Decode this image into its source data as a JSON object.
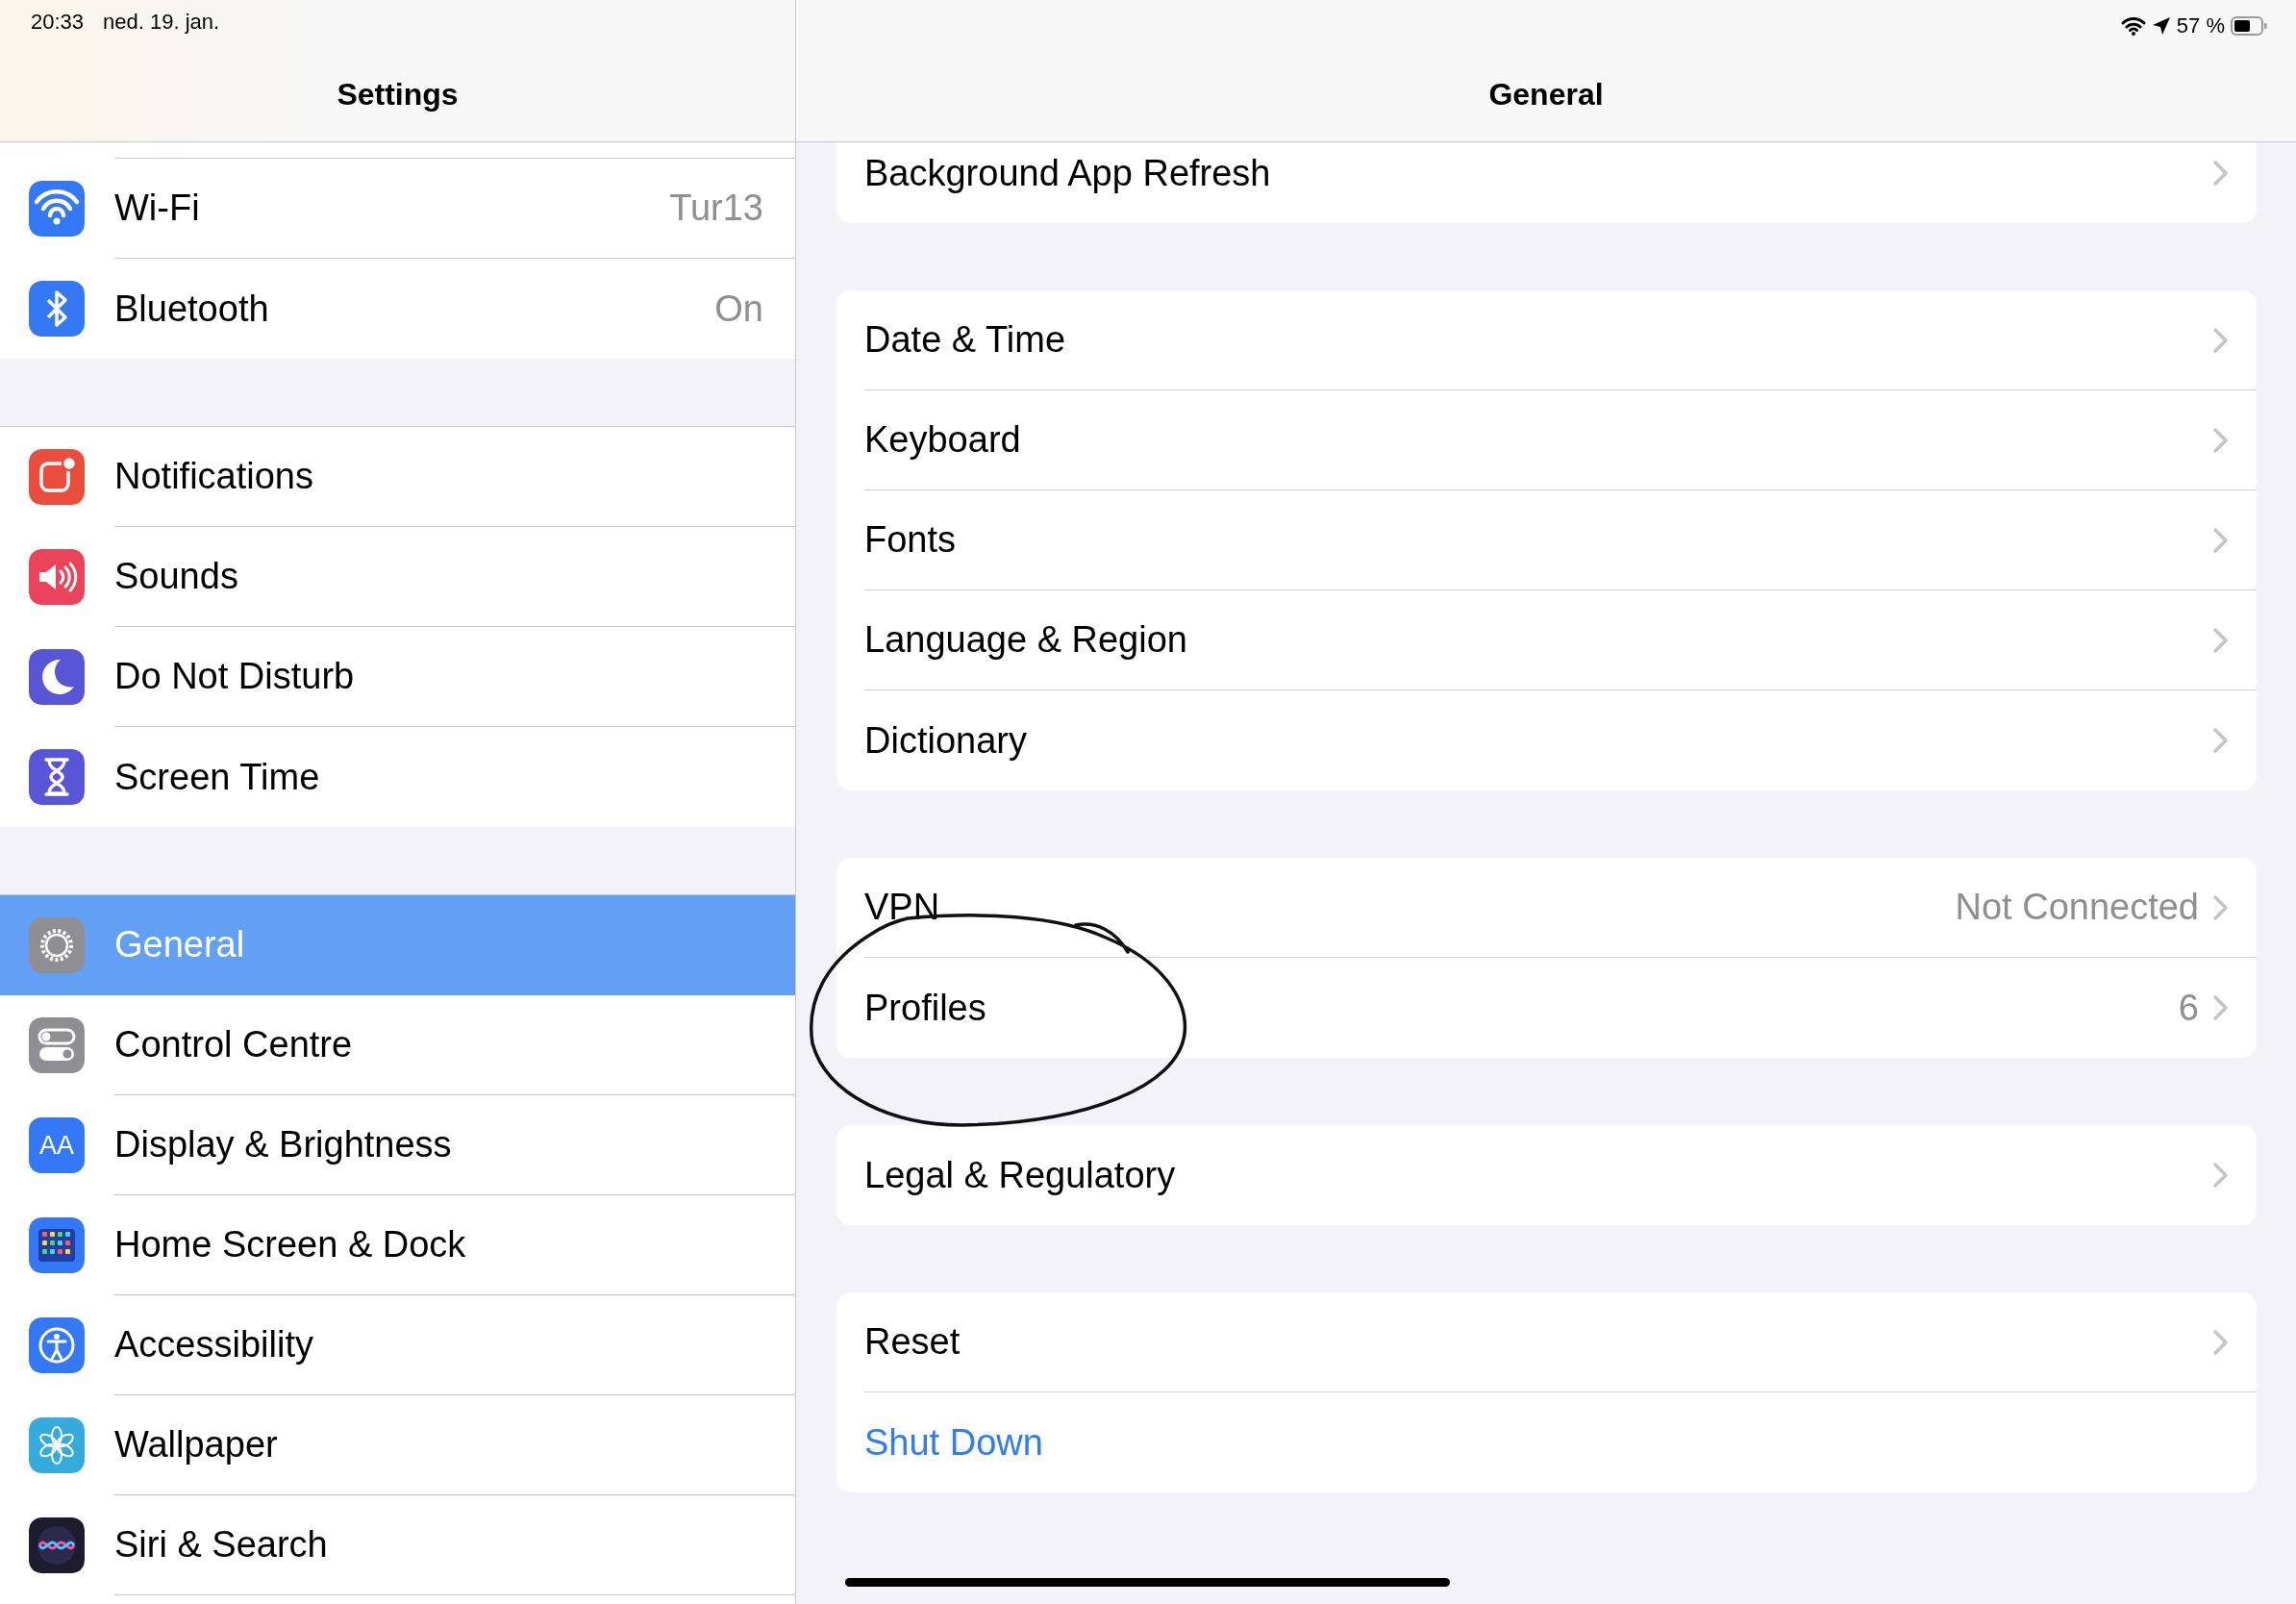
{
  "status_bar": {
    "time": "20:33",
    "date": "ned. 19. jan.",
    "battery": "57 %"
  },
  "sidebar": {
    "title": "Settings",
    "groups": [
      [
        {
          "label": "Wi-Fi",
          "value": "Tur13",
          "selected": false
        },
        {
          "label": "Bluetooth",
          "value": "On",
          "selected": false
        }
      ],
      [
        {
          "label": "Notifications",
          "selected": false
        },
        {
          "label": "Sounds",
          "selected": false
        },
        {
          "label": "Do Not Disturb",
          "selected": false
        },
        {
          "label": "Screen Time",
          "selected": false
        }
      ],
      [
        {
          "label": "General",
          "selected": true
        },
        {
          "label": "Control Centre",
          "selected": false
        },
        {
          "label": "Display & Brightness",
          "icon_text": "AA",
          "selected": false
        },
        {
          "label": "Home Screen & Dock",
          "selected": false
        },
        {
          "label": "Accessibility",
          "selected": false
        },
        {
          "label": "Wallpaper",
          "selected": false
        },
        {
          "label": "Siri & Search",
          "selected": false
        }
      ]
    ]
  },
  "detail": {
    "title": "General",
    "groups": [
      [
        {
          "label": "Background App Refresh",
          "kind": "nav"
        }
      ],
      [
        {
          "label": "Date & Time",
          "kind": "nav"
        },
        {
          "label": "Keyboard",
          "kind": "nav"
        },
        {
          "label": "Fonts",
          "kind": "nav"
        },
        {
          "label": "Language & Region",
          "kind": "nav"
        },
        {
          "label": "Dictionary",
          "kind": "nav"
        }
      ],
      [
        {
          "label": "VPN",
          "value": "Not Connected",
          "kind": "nav"
        },
        {
          "label": "Profiles",
          "value": "6",
          "kind": "nav"
        }
      ],
      [
        {
          "label": "Legal & Regulatory",
          "kind": "nav"
        }
      ],
      [
        {
          "label": "Reset",
          "kind": "nav"
        },
        {
          "label": "Shut Down",
          "kind": "action"
        }
      ]
    ]
  }
}
